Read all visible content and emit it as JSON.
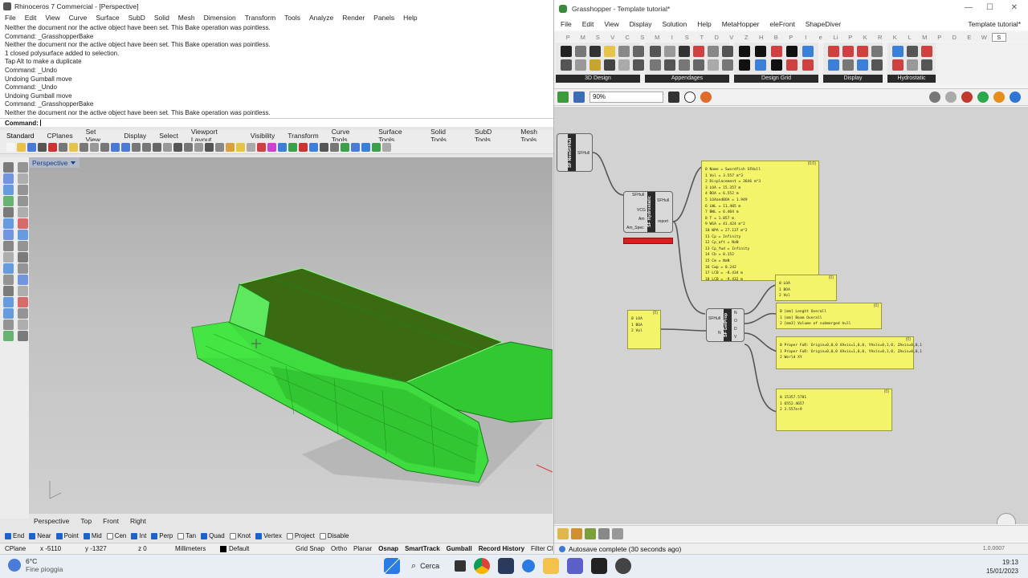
{
  "rhino": {
    "title": "Rhinoceros 7 Commercial - [Perspective]",
    "menu": [
      "File",
      "Edit",
      "View",
      "Curve",
      "Surface",
      "SubD",
      "Solid",
      "Mesh",
      "Dimension",
      "Transform",
      "Tools",
      "Analyze",
      "Render",
      "Panels",
      "Help"
    ],
    "history": [
      "Neither the document nor the active object have been set. This Bake operation was pointless.",
      "Command: _GrasshopperBake",
      "Neither the document nor the active object have been set. This Bake operation was pointless.",
      "1 closed polysurface added to selection.",
      "Tap Alt to make a duplicate",
      "Command: _Undo",
      "Undoing Gumball move",
      "Command: _Undo",
      "Undoing Gumball move",
      "Command: _GrasshopperBake",
      "Neither the document nor the active object have been set. This Bake operation was pointless."
    ],
    "command_label": "Command:",
    "tool_tabs": [
      "Standard",
      "CPlanes",
      "Set View",
      "Display",
      "Select",
      "Viewport Layout",
      "Visibility",
      "Transform",
      "Curve Tools",
      "Surface Tools",
      "Solid Tools",
      "SubD Tools",
      "Mesh Tools"
    ],
    "viewport_name": "Perspective",
    "view_tabs": [
      "Perspective",
      "Top",
      "Front",
      "Right"
    ],
    "osnaps": [
      {
        "label": "End",
        "on": true
      },
      {
        "label": "Near",
        "on": true
      },
      {
        "label": "Point",
        "on": true
      },
      {
        "label": "Mid",
        "on": true
      },
      {
        "label": "Cen",
        "on": false
      },
      {
        "label": "Int",
        "on": true
      },
      {
        "label": "Perp",
        "on": true
      },
      {
        "label": "Tan",
        "on": false
      },
      {
        "label": "Quad",
        "on": true
      },
      {
        "label": "Knot",
        "on": false
      },
      {
        "label": "Vertex",
        "on": true
      },
      {
        "label": "Project",
        "on": false
      },
      {
        "label": "Disable",
        "on": false
      }
    ],
    "status": {
      "cplane": "CPlane",
      "x": "x -5110",
      "y": "y -1327",
      "z": "z 0",
      "units": "Millimeters",
      "layer": "Default",
      "toggles": [
        "Grid Snap",
        "Ortho",
        "Planar",
        "Osnap",
        "SmartTrack",
        "Gumball",
        "Record History",
        "Filter"
      ],
      "bold_toggles": [
        "Osnap",
        "SmartTrack",
        "Gumball",
        "Record History"
      ],
      "filter_suffix": "Cl"
    },
    "hull_color": "#3cdc3c"
  },
  "gh": {
    "title": "Grasshopper - Template tutorial*",
    "menu": [
      "File",
      "Edit",
      "View",
      "Display",
      "Solution",
      "Help",
      "MetaHopper",
      "eleFront",
      "ShapeDiver"
    ],
    "menu_right": "Template tutorial*",
    "tab_letters": [
      "P",
      "M",
      "S",
      "V",
      "C",
      "S",
      "M",
      "I",
      "S",
      "T",
      "D",
      "V",
      "Z",
      "H",
      "B",
      "P",
      "I",
      "e",
      "Li",
      "P",
      "K",
      "R",
      "K",
      "L",
      "M",
      "P",
      "D",
      "E",
      "W",
      "S"
    ],
    "active_letter_index": 29,
    "ribbon_groups": [
      "3D Design",
      "Appendages",
      "Design Grid",
      "Display",
      "Hydrostatic"
    ],
    "zoom": "90%",
    "autosave": "Autosave complete (30 seconds ago)",
    "version": "1.0.0007",
    "nodes": {
      "new_hull": {
        "title": "SF NewSFHull",
        "out": "SFHull"
      },
      "hydrostatic": {
        "title": "SF Hydrostatic",
        "inputs": [
          "SFHull",
          "VCG",
          "Am",
          "Am_Spec"
        ],
        "outputs": [
          "SFHull",
          "report"
        ]
      },
      "getprop": {
        "title": "SF GetProp",
        "inputs": [
          "SFHull",
          "N"
        ],
        "outputs": [
          "N",
          "O",
          "D",
          "V"
        ]
      }
    },
    "panels": {
      "report": {
        "header": "{0;0}",
        "lines": [
          "0 Name = Swordfish SFHull",
          "1 Vol = 3.557 m^3",
          "2 Displacement = 3646 m^3",
          "3 LOA = 15.357 m",
          "4 BOA = 6.552 m",
          "5 LOAandBOA = 1.949",
          "6 LWL = 11.405 m",
          "7 BWL = 6.404 m",
          "8 T = 1.057 m",
          "9 WSA = 41.424 m^2",
          "10 WPA = 27.137 m^2",
          "11 Cp = Infinity",
          "12 Cp_aft = NaN",
          "13 Cp_fwd = Infinity",
          "14 Cb = 0.152",
          "15 Cm = NaN",
          "16 Cwp = 0.242",
          "17 LCB = -8.434 m",
          "18 LCB = -9.432 m"
        ]
      },
      "mid_small": {
        "header": "{0}",
        "lines": [
          "0 LOA",
          "1 BOA",
          "2 Vol"
        ]
      },
      "left_small": {
        "header": "{0}",
        "lines": [
          "0 LOA",
          "1 BOA",
          "2 Vol"
        ]
      },
      "names": {
        "header": "{0}",
        "lines": [
          "0 [mm] Lenght Overall",
          "1 [mm] Beam Overall",
          "2 [mm3] Volume of submerged hull"
        ]
      },
      "frames": {
        "header": "{0}",
        "lines": [
          "0 Proper FoR: Origin=0,0,0 XAxis=1,0,0, YAxis=0,1,0, ZAxis=0,0,1",
          "1 Proper FoR: Origin=0,0,0 XAxis=1,0,0, YAxis=0,1,0, ZAxis=0,0,1",
          "2 World XY"
        ]
      },
      "values": {
        "header": "{0}",
        "lines": [
          "0 15357.5781",
          "1 6552.4657",
          "2 3.557e+9"
        ]
      }
    }
  },
  "taskbar": {
    "temp": "6°C",
    "weather": "Fine pioggia",
    "search": "Cerca",
    "time": "19:13",
    "date": "15/01/2023"
  }
}
